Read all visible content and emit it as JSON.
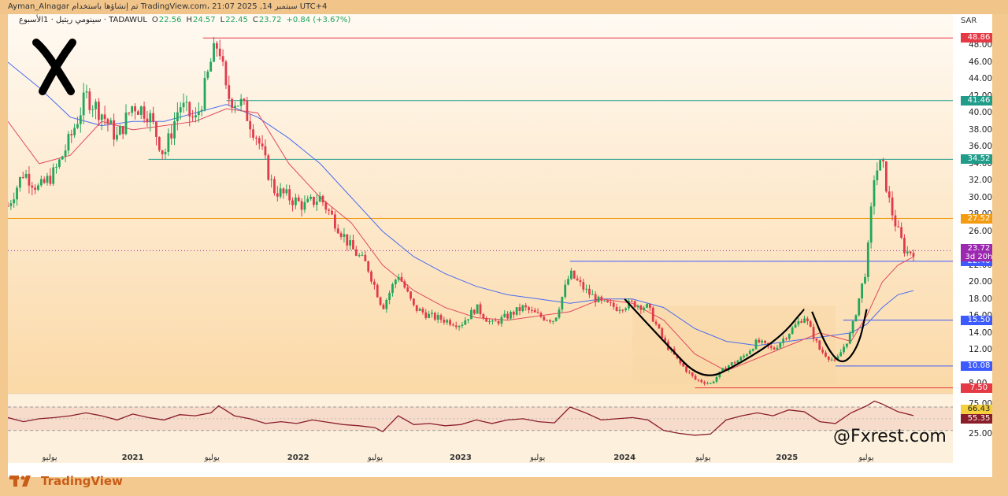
{
  "header": {
    "author": "Ayman_Alnagar",
    "published_text": "تم إنشاؤها باستخدام TradingView.com، 21:07 2025 ,14 سبتمبر UTC+4",
    "symbol_line": "سينومي ريتيل · 1الأسبوع · TADAWUL",
    "open_label": "O",
    "open": "22.56",
    "high_label": "H",
    "high": "24.57",
    "low_label": "L",
    "low": "22.45",
    "close_label": "C",
    "close": "23.72",
    "change": "+0.84 (+3.67%)",
    "currency": "SAR"
  },
  "footer": {
    "brand": "TradingView",
    "watermark": "@Fxrest.com"
  },
  "logo": {
    "icon": "x-mark-logo"
  },
  "colors": {
    "background": "#f4c98f",
    "up": "#22a65a",
    "down": "#e13a4b",
    "ma_fast": "#e04a5f",
    "ma_slow": "#4a6cf0",
    "rsi_line": "#8a1d2a",
    "level_teal": "#1f9c8a",
    "level_blue": "#3d5afe",
    "level_orange": "#f39c12",
    "level_red": "#e53946"
  },
  "chart_data": [
    {
      "type": "candlestick",
      "timeframe": "1 week",
      "ylim": [
        7,
        50
      ],
      "y_ticks": [
        "8.00",
        "12.00",
        "14.00",
        "16.00",
        "18.00",
        "20.00",
        "22.00",
        "24.00",
        "26.00",
        "28.00",
        "30.00",
        "32.00",
        "34.00",
        "36.00",
        "38.00",
        "40.00",
        "42.00",
        "44.00",
        "46.00",
        "48.00"
      ],
      "x_ticks": [
        {
          "label": "يوليو",
          "t": 0.056,
          "year": false
        },
        {
          "label": "2021",
          "t": 0.158,
          "year": true
        },
        {
          "label": "يوليو",
          "t": 0.264,
          "year": false
        },
        {
          "label": "2022",
          "t": 0.37,
          "year": true
        },
        {
          "label": "يوليو",
          "t": 0.473,
          "year": false
        },
        {
          "label": "2023",
          "t": 0.578,
          "year": true
        },
        {
          "label": "يوليو",
          "t": 0.681,
          "year": false
        },
        {
          "label": "2024",
          "t": 0.788,
          "year": true
        },
        {
          "label": "يوليو",
          "t": 0.893,
          "year": false
        },
        {
          "label": "2025",
          "t": 0.996,
          "year": true
        },
        {
          "label": "يوليو",
          "t": 1.102,
          "year": false
        }
      ],
      "price_path": [
        [
          0.0,
          29
        ],
        [
          0.02,
          33
        ],
        [
          0.04,
          31
        ],
        [
          0.06,
          33
        ],
        [
          0.08,
          37
        ],
        [
          0.1,
          42
        ],
        [
          0.12,
          40
        ],
        [
          0.14,
          37
        ],
        [
          0.16,
          41
        ],
        [
          0.18,
          40
        ],
        [
          0.2,
          35
        ],
        [
          0.22,
          41
        ],
        [
          0.24,
          39
        ],
        [
          0.25,
          42
        ],
        [
          0.26,
          46
        ],
        [
          0.27,
          48.5
        ],
        [
          0.28,
          42
        ],
        [
          0.3,
          41
        ],
        [
          0.32,
          37
        ],
        [
          0.34,
          31
        ],
        [
          0.36,
          30
        ],
        [
          0.38,
          29
        ],
        [
          0.4,
          30
        ],
        [
          0.42,
          27
        ],
        [
          0.44,
          24
        ],
        [
          0.46,
          22
        ],
        [
          0.48,
          17
        ],
        [
          0.5,
          21
        ],
        [
          0.52,
          17
        ],
        [
          0.54,
          16
        ],
        [
          0.56,
          15.5
        ],
        [
          0.58,
          15
        ],
        [
          0.6,
          17
        ],
        [
          0.62,
          15
        ],
        [
          0.64,
          16
        ],
        [
          0.66,
          17
        ],
        [
          0.68,
          16
        ],
        [
          0.7,
          15.5
        ],
        [
          0.72,
          21
        ],
        [
          0.74,
          19
        ],
        [
          0.76,
          17.5
        ],
        [
          0.78,
          17
        ],
        [
          0.8,
          17.5
        ],
        [
          0.82,
          17
        ],
        [
          0.84,
          13
        ],
        [
          0.86,
          10.5
        ],
        [
          0.88,
          8.5
        ],
        [
          0.9,
          8
        ],
        [
          0.92,
          10
        ],
        [
          0.94,
          11
        ],
        [
          0.96,
          13
        ],
        [
          0.98,
          12
        ],
        [
          1.0,
          14
        ],
        [
          1.02,
          16
        ],
        [
          1.04,
          12
        ],
        [
          1.06,
          10.5
        ],
        [
          1.08,
          14
        ],
        [
          1.1,
          22
        ],
        [
          1.11,
          33
        ],
        [
          1.12,
          34
        ],
        [
          1.13,
          29
        ],
        [
          1.14,
          26
        ],
        [
          1.15,
          23.5
        ],
        [
          1.16,
          23.72
        ]
      ],
      "ma_fast": [
        [
          0.0,
          39
        ],
        [
          0.04,
          34
        ],
        [
          0.08,
          35
        ],
        [
          0.12,
          39
        ],
        [
          0.16,
          38
        ],
        [
          0.2,
          38.5
        ],
        [
          0.24,
          39
        ],
        [
          0.28,
          40.5
        ],
        [
          0.32,
          40
        ],
        [
          0.36,
          34
        ],
        [
          0.4,
          30
        ],
        [
          0.44,
          27
        ],
        [
          0.48,
          22
        ],
        [
          0.52,
          19
        ],
        [
          0.56,
          17
        ],
        [
          0.6,
          15.8
        ],
        [
          0.64,
          15.5
        ],
        [
          0.68,
          16
        ],
        [
          0.72,
          16.5
        ],
        [
          0.76,
          18
        ],
        [
          0.8,
          17.5
        ],
        [
          0.84,
          15.5
        ],
        [
          0.88,
          11.5
        ],
        [
          0.92,
          9.5
        ],
        [
          0.96,
          11
        ],
        [
          1.0,
          12.5
        ],
        [
          1.04,
          14
        ],
        [
          1.08,
          13
        ],
        [
          1.1,
          16
        ],
        [
          1.12,
          20
        ],
        [
          1.14,
          22
        ],
        [
          1.16,
          23
        ]
      ],
      "ma_slow": [
        [
          0.0,
          46
        ],
        [
          0.04,
          43
        ],
        [
          0.08,
          39.5
        ],
        [
          0.12,
          38.5
        ],
        [
          0.16,
          39
        ],
        [
          0.2,
          39
        ],
        [
          0.24,
          40
        ],
        [
          0.28,
          41
        ],
        [
          0.32,
          39.5
        ],
        [
          0.36,
          37
        ],
        [
          0.4,
          34
        ],
        [
          0.44,
          30
        ],
        [
          0.48,
          26
        ],
        [
          0.52,
          23
        ],
        [
          0.56,
          21
        ],
        [
          0.6,
          19.5
        ],
        [
          0.64,
          18.5
        ],
        [
          0.68,
          18
        ],
        [
          0.72,
          17.5
        ],
        [
          0.76,
          18
        ],
        [
          0.8,
          18
        ],
        [
          0.84,
          17
        ],
        [
          0.88,
          14.5
        ],
        [
          0.92,
          13
        ],
        [
          0.96,
          12.5
        ],
        [
          1.0,
          13
        ],
        [
          1.04,
          13.5
        ],
        [
          1.08,
          14
        ],
        [
          1.1,
          15
        ],
        [
          1.12,
          17
        ],
        [
          1.14,
          18.5
        ],
        [
          1.16,
          19
        ]
      ],
      "levels": [
        {
          "label": "48.86",
          "value": 48.86,
          "color": "#e53946",
          "from": 0.25
        },
        {
          "label": "41.46",
          "value": 41.46,
          "color": "#1f9c8a",
          "from": 0.28
        },
        {
          "label": "34.52",
          "value": 34.52,
          "color": "#1f9c8a",
          "from": 0.18
        },
        {
          "label": "27.52",
          "value": 27.52,
          "color": "#f39c12",
          "from": 0.0
        },
        {
          "label": "22.46",
          "value": 22.46,
          "color": "#3d5afe",
          "from": 0.72
        },
        {
          "label": "15.50",
          "value": 15.5,
          "color": "#3d5afe",
          "from": 1.07
        },
        {
          "label": "10.08",
          "value": 10.08,
          "color": "#3d5afe",
          "from": 1.06
        },
        {
          "label": "7.50",
          "value": 7.5,
          "color": "#e53946",
          "from": 0.88
        }
      ],
      "current_price": {
        "value": "23.72",
        "countdown": "3d 20h",
        "color": "#9c27b0"
      },
      "annotations": [
        {
          "type": "cup",
          "label": "cup arc",
          "points": [
            [
              0.79,
              18
            ],
            [
              0.84,
              13
            ],
            [
              0.89,
              8.2
            ],
            [
              0.94,
              10.5
            ],
            [
              0.99,
              13.5
            ],
            [
              1.02,
              16.8
            ]
          ]
        },
        {
          "type": "handle",
          "label": "handle arc",
          "points": [
            [
              1.03,
              16.5
            ],
            [
              1.05,
              12
            ],
            [
              1.07,
              10.1
            ],
            [
              1.09,
              12.5
            ],
            [
              1.1,
              16.8
            ]
          ]
        }
      ]
    },
    {
      "type": "line",
      "indicator": "RSI",
      "ylim": [
        15,
        82
      ],
      "y_ticks": [
        "25.00",
        "75.00"
      ],
      "band": [
        30,
        70
      ],
      "values_labels": [
        {
          "label": "66.43",
          "value": 66.43,
          "color": "#f4d03f",
          "text_color": "#222"
        },
        {
          "label": "55.35",
          "value": 55.35,
          "color": "#8a1d2a",
          "text_color": "#fff"
        }
      ],
      "rsi_path": [
        [
          0.0,
          52
        ],
        [
          0.02,
          45
        ],
        [
          0.04,
          50
        ],
        [
          0.06,
          52
        ],
        [
          0.08,
          55
        ],
        [
          0.1,
          60
        ],
        [
          0.12,
          55
        ],
        [
          0.14,
          48
        ],
        [
          0.16,
          58
        ],
        [
          0.18,
          52
        ],
        [
          0.2,
          48
        ],
        [
          0.22,
          57
        ],
        [
          0.24,
          55
        ],
        [
          0.26,
          60
        ],
        [
          0.27,
          72
        ],
        [
          0.29,
          55
        ],
        [
          0.31,
          50
        ],
        [
          0.33,
          42
        ],
        [
          0.35,
          45
        ],
        [
          0.37,
          42
        ],
        [
          0.39,
          48
        ],
        [
          0.41,
          44
        ],
        [
          0.43,
          40
        ],
        [
          0.45,
          38
        ],
        [
          0.47,
          35
        ],
        [
          0.48,
          28
        ],
        [
          0.5,
          55
        ],
        [
          0.52,
          40
        ],
        [
          0.54,
          42
        ],
        [
          0.56,
          38
        ],
        [
          0.58,
          40
        ],
        [
          0.6,
          48
        ],
        [
          0.62,
          42
        ],
        [
          0.64,
          48
        ],
        [
          0.66,
          50
        ],
        [
          0.68,
          45
        ],
        [
          0.7,
          43
        ],
        [
          0.72,
          70
        ],
        [
          0.74,
          60
        ],
        [
          0.76,
          48
        ],
        [
          0.78,
          50
        ],
        [
          0.8,
          52
        ],
        [
          0.82,
          48
        ],
        [
          0.84,
          30
        ],
        [
          0.86,
          25
        ],
        [
          0.88,
          22
        ],
        [
          0.9,
          24
        ],
        [
          0.92,
          48
        ],
        [
          0.94,
          55
        ],
        [
          0.96,
          60
        ],
        [
          0.98,
          55
        ],
        [
          1.0,
          65
        ],
        [
          1.02,
          62
        ],
        [
          1.04,
          45
        ],
        [
          1.06,
          42
        ],
        [
          1.08,
          60
        ],
        [
          1.1,
          72
        ],
        [
          1.11,
          80
        ],
        [
          1.12,
          75
        ],
        [
          1.14,
          62
        ],
        [
          1.16,
          55.35
        ]
      ]
    }
  ]
}
